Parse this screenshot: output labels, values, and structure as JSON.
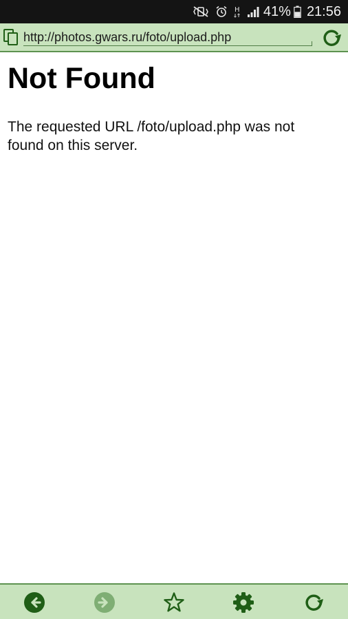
{
  "status_bar": {
    "battery_percent": "41%",
    "clock": "21:56",
    "network_label": "H",
    "icons": [
      "mute-vibrate-icon",
      "alarm-icon",
      "network-type-icon",
      "signal-strength-icon",
      "battery-icon"
    ]
  },
  "address_bar": {
    "url": "http://photos.gwars.ru/foto/upload.php",
    "icons": [
      "copy-icon",
      "reload-icon"
    ]
  },
  "page": {
    "title": "Not Found",
    "message": "The requested URL /foto/upload.php was not found on this server."
  },
  "toolbar": {
    "buttons": [
      {
        "name": "back",
        "icon": "back-arrow-icon",
        "enabled": true
      },
      {
        "name": "forward",
        "icon": "forward-arrow-icon",
        "enabled": false
      },
      {
        "name": "bookmark",
        "icon": "star-icon",
        "enabled": true
      },
      {
        "name": "settings",
        "icon": "gear-icon",
        "enabled": true
      },
      {
        "name": "reload",
        "icon": "reload-icon",
        "enabled": true
      }
    ]
  },
  "colors": {
    "status_bar_bg": "#141414",
    "bar_bg": "#c8e3bd",
    "bar_border": "#5d9250",
    "icon_green": "#1f5e16",
    "icon_disabled": "#7fae74"
  }
}
